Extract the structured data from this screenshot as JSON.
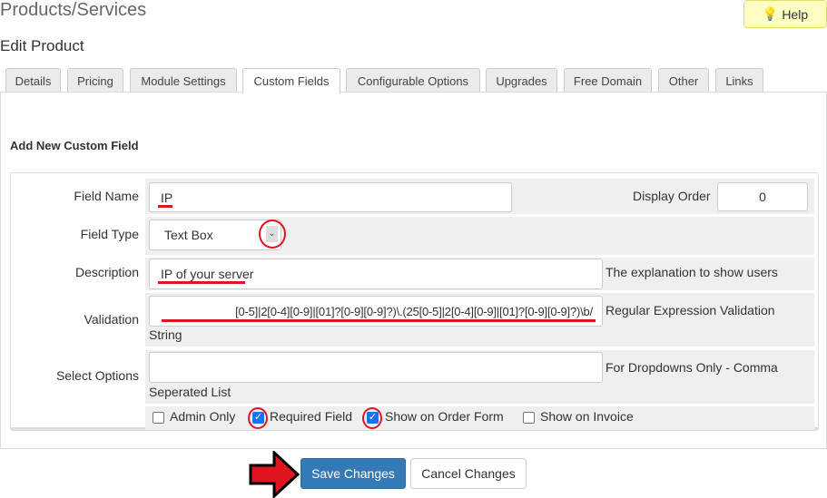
{
  "header": {
    "title": "Products/Services",
    "help_label": "Help",
    "subtitle": "Edit Product"
  },
  "tabs": [
    {
      "label": "Details"
    },
    {
      "label": "Pricing"
    },
    {
      "label": "Module Settings"
    },
    {
      "label": "Custom Fields",
      "active": true
    },
    {
      "label": "Configurable Options"
    },
    {
      "label": "Upgrades"
    },
    {
      "label": "Free Domain"
    },
    {
      "label": "Other"
    },
    {
      "label": "Links"
    }
  ],
  "form": {
    "heading": "Add New Custom Field",
    "field_name": {
      "label": "Field Name",
      "value": "IP"
    },
    "display_order": {
      "label": "Display Order",
      "value": "0"
    },
    "field_type": {
      "label": "Field Type",
      "value": "Text Box"
    },
    "description": {
      "label": "Description",
      "value": "IP of your server",
      "note": "The explanation to show users"
    },
    "validation": {
      "label": "Validation",
      "value": "[0-5]|2[0-4][0-9]|[01]?[0-9][0-9]?)\\.(25[0-5]|2[0-4][0-9]|[01]?[0-9][0-9]?)\\b/",
      "note1": "Regular Expression Validation",
      "note2": "String"
    },
    "select_options": {
      "label": "Select Options",
      "value": "",
      "note1": "For Dropdowns Only - Comma",
      "note2": "Seperated List"
    },
    "checkboxes": [
      {
        "label": "Admin Only",
        "checked": false
      },
      {
        "label": "Required Field",
        "checked": true
      },
      {
        "label": "Show on Order Form",
        "checked": true
      },
      {
        "label": "Show on Invoice",
        "checked": false
      }
    ]
  },
  "buttons": {
    "save": "Save Changes",
    "cancel": "Cancel Changes"
  },
  "colors": {
    "primary": "#337ab7",
    "annotation": "#e0161e",
    "help_bg": "#ffffc4"
  }
}
